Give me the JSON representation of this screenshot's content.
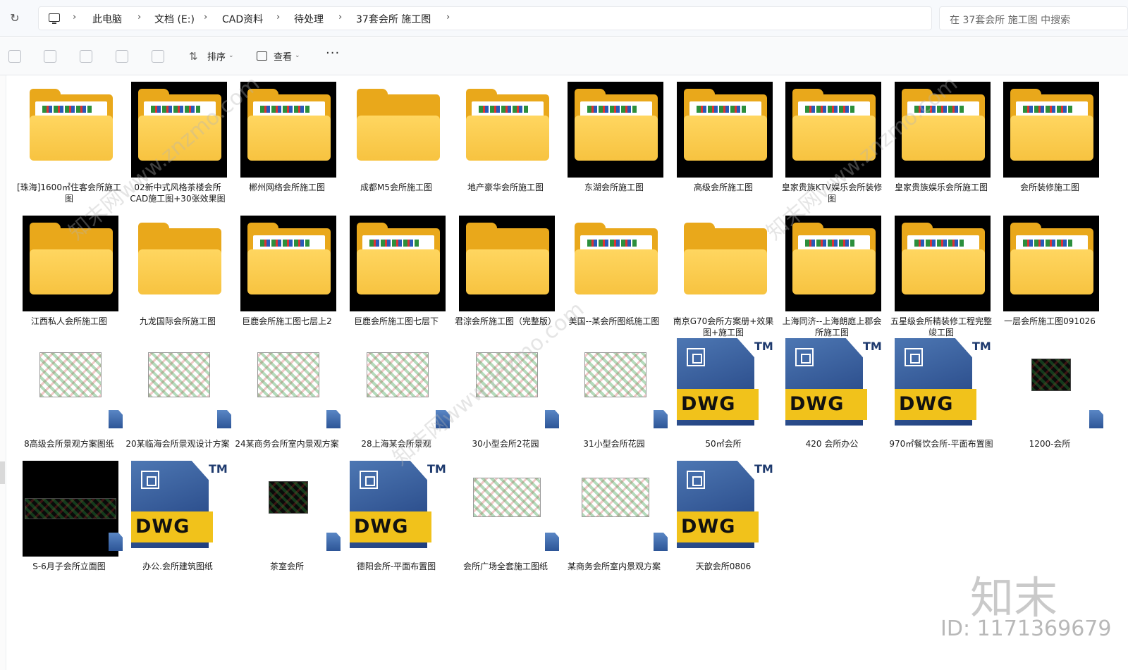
{
  "address_bar": {
    "crumbs": [
      "此电脑",
      "文档 (E:)",
      "CAD资料",
      "待处理",
      "37套会所 施工图"
    ],
    "search_placeholder": "在 37套会所 施工图 中搜索"
  },
  "command_bar": {
    "sort_label": "排序",
    "view_label": "查看",
    "more_label": "···",
    "sort_icon": "sort-icon",
    "view_icon": "view-icon"
  },
  "items": [
    {
      "name": "[珠海]1600㎡住客会所施工图",
      "type": "folder"
    },
    {
      "name": "02新中式风格茶楼会所CAD施工图+30张效果图",
      "type": "folder"
    },
    {
      "name": "郴州网络会所施工图",
      "type": "folder"
    },
    {
      "name": "成都M5会所施工图",
      "type": "folder"
    },
    {
      "name": "地产豪华会所施工图",
      "type": "folder"
    },
    {
      "name": "东湖会所施工图",
      "type": "folder"
    },
    {
      "name": "高级会所施工图",
      "type": "folder"
    },
    {
      "name": "皇家贵族KTV娱乐会所装修图",
      "type": "folder"
    },
    {
      "name": "皇家贵族娱乐会所施工图",
      "type": "folder"
    },
    {
      "name": "会所装修施工图",
      "type": "folder"
    },
    {
      "name": "江西私人会所施工图",
      "type": "folder"
    },
    {
      "name": "九龙国际会所施工图",
      "type": "folder"
    },
    {
      "name": "巨鹿会所施工图七层上2",
      "type": "folder"
    },
    {
      "name": "巨鹿会所施工图七层下",
      "type": "folder"
    },
    {
      "name": "君淙会所施工图（完整版）",
      "type": "folder"
    },
    {
      "name": "美国--某会所图纸施工图",
      "type": "folder"
    },
    {
      "name": "南京G70会所方案册+效果图+施工图",
      "type": "folder"
    },
    {
      "name": "上海同济--上海朗庭上郡会所施工图",
      "type": "folder"
    },
    {
      "name": "五星级会所精装修工程完整竣工图",
      "type": "folder"
    },
    {
      "name": "一层会所施工图091026",
      "type": "folder"
    },
    {
      "name": "8高级会所景观方案图纸",
      "type": "dwg"
    },
    {
      "name": "20某临海会所景观设计方案",
      "type": "dwg"
    },
    {
      "name": "24某商务会所室内景观方案",
      "type": "dwg"
    },
    {
      "name": "28上海某会所景观",
      "type": "dwg"
    },
    {
      "name": "30小型会所2花园",
      "type": "dwg"
    },
    {
      "name": "31小型会所花园",
      "type": "dwg"
    },
    {
      "name": "50㎡会所",
      "type": "dwg"
    },
    {
      "name": "420 会所办公",
      "type": "dwg"
    },
    {
      "name": "970㎡餐饮会所-平面布置图",
      "type": "dwg"
    },
    {
      "name": "1200-会所",
      "type": "dwg"
    },
    {
      "name": "S-6月子会所立面图",
      "type": "dwg"
    },
    {
      "name": "办公.会所建筑图纸",
      "type": "dwg"
    },
    {
      "name": "茶室会所",
      "type": "dwg"
    },
    {
      "name": "德阳会所-平面布置图",
      "type": "dwg"
    },
    {
      "name": "会所广场全套施工图纸",
      "type": "dwg"
    },
    {
      "name": "某商务会所室内景观方案",
      "type": "dwg"
    },
    {
      "name": "天歆会所0806",
      "type": "dwg"
    }
  ],
  "dwg_badge": {
    "text": "DWG",
    "tm": "TM"
  },
  "watermark": {
    "brand": "知末",
    "id": "ID: 1171369679",
    "diag": "知末网www.znzmo.com"
  },
  "colors": {
    "folder": "#f7c340",
    "dwg_blue": "#2d5597",
    "dwg_yellow": "#f1c21b"
  }
}
